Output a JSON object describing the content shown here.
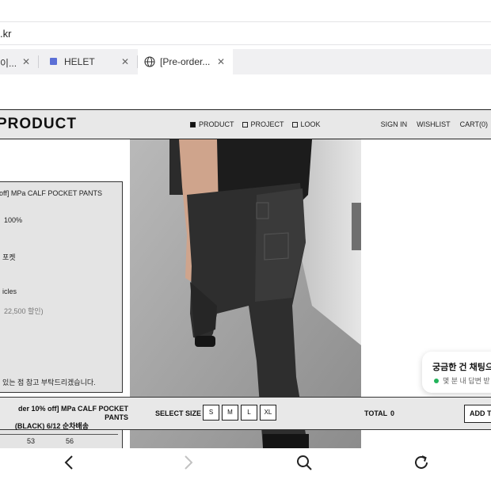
{
  "browser": {
    "url": ".kr",
    "tabs": [
      {
        "title": "이...",
        "icon": "partial-favicon"
      },
      {
        "title": "HELET",
        "icon": "page-icon"
      },
      {
        "title": "[Pre-order...",
        "icon": "globe-icon",
        "active": true
      }
    ],
    "toolbar": {
      "back": "chevron-left-icon",
      "forward": "chevron-right-icon",
      "search": "search-icon",
      "reload": "reload-icon"
    }
  },
  "site": {
    "logo": "PRODUCT",
    "nav": [
      {
        "label": "PRODUCT",
        "selected": true
      },
      {
        "label": "PROJECT",
        "selected": false
      },
      {
        "label": "LOOK",
        "selected": false
      }
    ],
    "util": {
      "sign_in": "SIGN IN",
      "wishlist": "WISHLIST",
      "cart": "CART(0)"
    }
  },
  "info_panel": {
    "lines": [
      "off] MPa CALF POCKET PANTS",
      "100%",
      "포켓",
      "icles",
      "22,500 할인)",
      "있는 점 참고 부탁드리겠습니다."
    ]
  },
  "purchase_bar": {
    "product_name_line1": "der 10% off] MPa CALF POCKET PANTS",
    "product_name_line2": "(BLACK) 6/12 순차배송",
    "select_size_label": "SELECT SIZE",
    "sizes": [
      "S",
      "M",
      "L",
      "XL"
    ],
    "total_label": "TOTAL",
    "total_value": "0",
    "add_button": "ADD T"
  },
  "size_table_partial": [
    "53",
    "56"
  ],
  "chat_widget": {
    "title": "궁금한 건 채팅으",
    "status": "몇 분 내 답변 받"
  },
  "colors": {
    "header_bg": "#e8e8e8",
    "panel_bg": "#e4e4e4",
    "online_dot": "#22b35a"
  }
}
